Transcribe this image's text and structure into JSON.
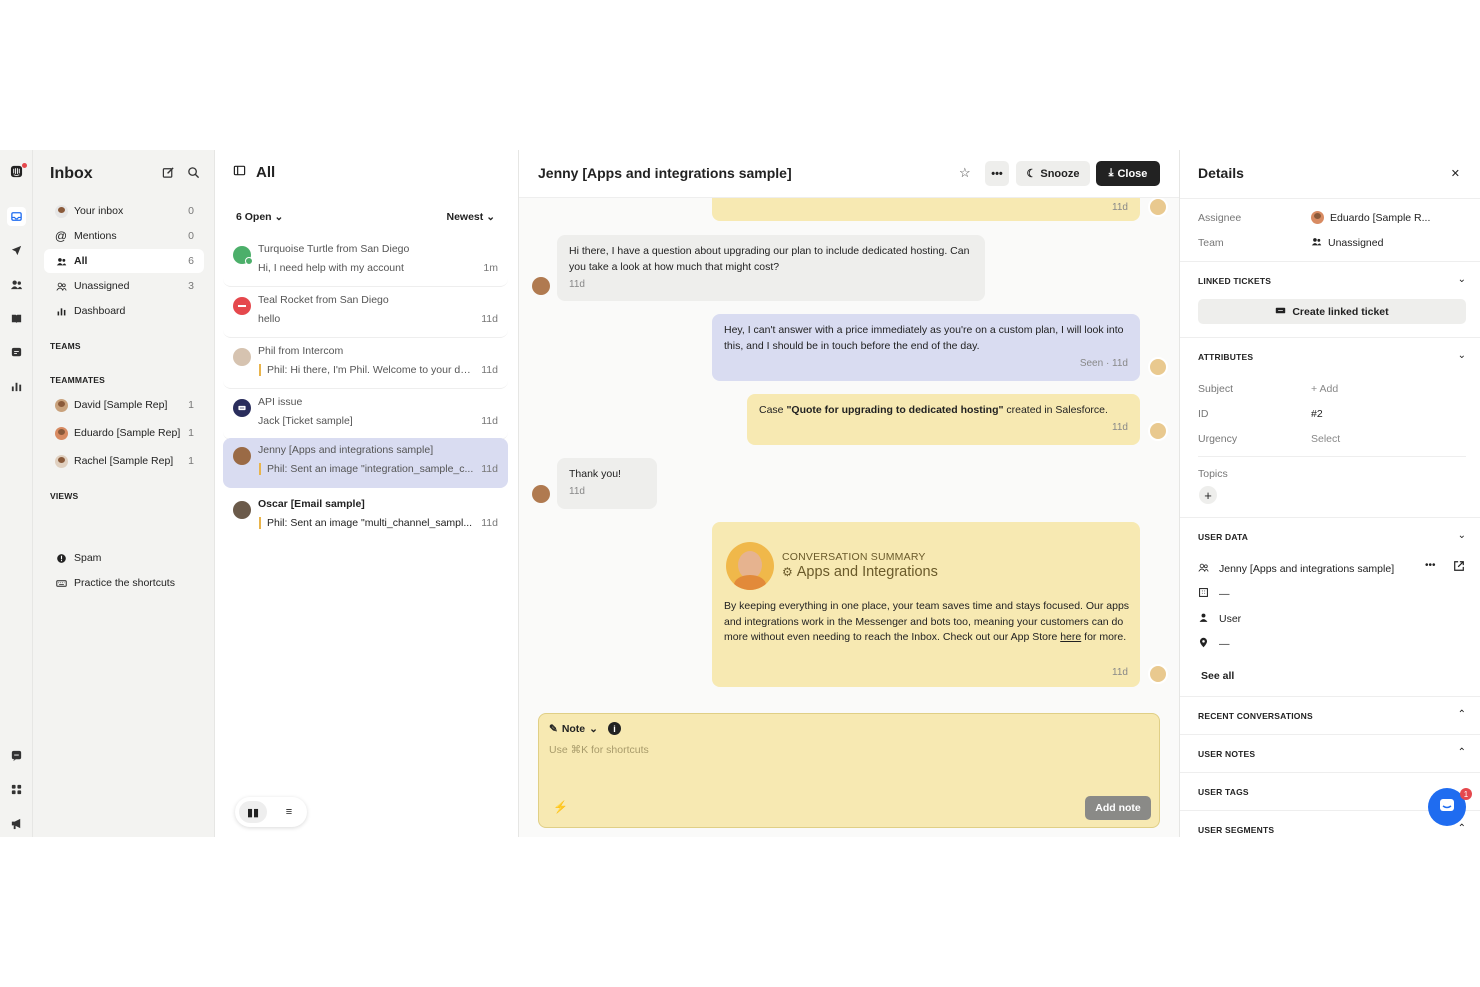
{
  "nav": {
    "title": "Inbox",
    "items": [
      {
        "label": "Your inbox",
        "count": "0"
      },
      {
        "label": "Mentions",
        "count": "0"
      },
      {
        "label": "All",
        "count": "6"
      },
      {
        "label": "Unassigned",
        "count": "3"
      },
      {
        "label": "Dashboard",
        "count": ""
      }
    ],
    "teams_label": "TEAMS",
    "teammates_label": "TEAMMATES",
    "teammates": [
      {
        "label": "David [Sample Rep]",
        "count": "1"
      },
      {
        "label": "Eduardo [Sample Rep]",
        "count": "1"
      },
      {
        "label": "Rachel [Sample Rep]",
        "count": "1"
      }
    ],
    "views_label": "VIEWS",
    "bottom": [
      {
        "label": "Spam"
      },
      {
        "label": "Practice the shortcuts"
      }
    ]
  },
  "list": {
    "title": "All",
    "filter": "6 Open",
    "sort": "Newest",
    "conversations": [
      {
        "name": "Turquoise Turtle from San Diego",
        "preview": "Hi, I need help with my account",
        "time": "1m",
        "avatar_color": "#4caf6a"
      },
      {
        "name": "Teal Rocket from San Diego",
        "preview": "hello",
        "time": "11d",
        "avatar_color": "#e5484d"
      },
      {
        "name": "Phil from Intercom",
        "preview": "Phil: Hi there, I'm Phil. Welcome to your de...",
        "time": "11d",
        "avatar_color": "#d6c3b0"
      },
      {
        "name": "API issue",
        "preview": "Jack [Ticket sample]",
        "time": "11d",
        "avatar_color": "#2a2d5c"
      },
      {
        "name": "Jenny [Apps and integrations sample]",
        "preview": "Phil: Sent an image \"integration_sample_c...",
        "time": "11d",
        "avatar_color": "#9a6a45"
      },
      {
        "name": "Oscar [Email sample]",
        "preview": "Phil: Sent an image \"multi_channel_sampl...",
        "time": "11d",
        "avatar_color": "#6b5a4a"
      }
    ]
  },
  "chat": {
    "title": "Jenny [Apps and integrations sample]",
    "snooze": "Snooze",
    "close": "Close",
    "top_time": "11d",
    "msg1": {
      "text": "Hi there, I have a question about upgrading our plan to include dedicated hosting. Can you take a look at how much that might cost?",
      "time": "11d"
    },
    "msg2": {
      "text": "Hey, I can't answer with a price immediately as you're on a custom plan, I will look into this, and I should be in touch before the end of the day.",
      "time": "Seen · 11d"
    },
    "case": {
      "prefix": "Case ",
      "bold": "\"Quote for upgrading to dedicated hosting\"",
      "suffix": " created in Salesforce.",
      "time": "11d"
    },
    "msg3": {
      "text": "Thank you!",
      "time": "11d"
    },
    "summary": {
      "label": "CONVERSATION SUMMARY",
      "title": "Apps and Integrations",
      "body_pre": "By keeping everything in one place, your team saves time and stays focused. Our apps and integrations work in the Messenger and bots too, meaning your customers can do more without even needing to reach the Inbox. Check out our App Store ",
      "link": "here",
      "body_post": " for more.",
      "time": "11d"
    },
    "composer": {
      "mode": "Note",
      "placeholder": "Use ⌘K for shortcuts",
      "add": "Add note"
    }
  },
  "details": {
    "title": "Details",
    "assignee_label": "Assignee",
    "assignee": "Eduardo [Sample R...",
    "team_label": "Team",
    "team": "Unassigned",
    "linked_tickets": "LINKED TICKETS",
    "create_ticket": "Create linked ticket",
    "attributes": "ATTRIBUTES",
    "subject_label": "Subject",
    "subject": "+ Add",
    "id_label": "ID",
    "id": "#2",
    "urgency_label": "Urgency",
    "urgency": "Select",
    "topics_label": "Topics",
    "user_data": "USER DATA",
    "user_name": "Jenny [Apps and integrations sample]",
    "company": "—",
    "role": "User",
    "location": "—",
    "see_all": "See all",
    "recent": "RECENT CONVERSATIONS",
    "notes": "USER NOTES",
    "tags": "USER TAGS",
    "segments": "USER SEGMENTS",
    "unread_badge": "1"
  }
}
